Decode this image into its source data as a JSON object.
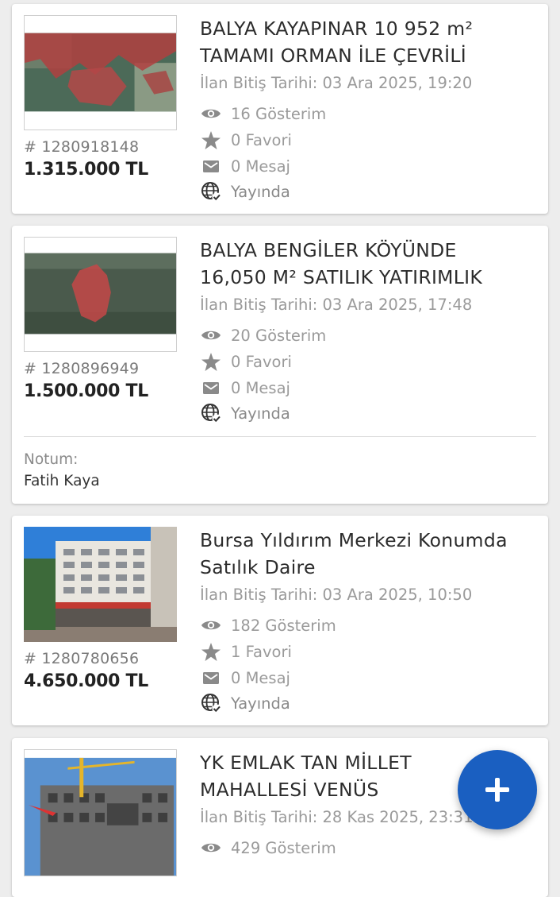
{
  "stat_icons": {
    "views": "eye-icon",
    "favorites": "star-icon",
    "messages": "envelope-icon",
    "status": "globe-check-icon"
  },
  "colors": {
    "fab": "#1a5fc1",
    "muted_text": "#9a9a9a",
    "price_text": "#222222"
  },
  "listings": [
    {
      "title": "BALYA KAYAPINAR 10 952 m²\nTAMAMI ORMAN İLE ÇEVRİLİ",
      "end_date": "İlan Bitiş Tarihi: 03 Ara 2025, 19:20",
      "views": "16 Gösterim",
      "favorites": "0 Favori",
      "messages": "0 Mesaj",
      "status": "Yayında",
      "listing_no": "# 1280918148",
      "price": "1.315.000 TL",
      "image": "aerial-map-red-parcels"
    },
    {
      "title": "BALYA BENGİLER KÖYÜNDE\n16,050 M² SATILIK YATIRIMLIK",
      "end_date": "İlan Bitiş Tarihi: 03 Ara 2025, 17:48",
      "views": "20 Gösterim",
      "favorites": "0 Favori",
      "messages": "0 Mesaj",
      "status": "Yayında",
      "listing_no": "# 1280896949",
      "price": "1.500.000 TL",
      "note_label": "Notum:",
      "note": "Fatih Kaya",
      "image": "aerial-map-red-parcel"
    },
    {
      "title": "Bursa Yıldırım Merkezi Konumda\nSatılık Daire",
      "end_date": "İlan Bitiş Tarihi: 03 Ara 2025, 10:50",
      "views": "182 Gösterim",
      "favorites": "1 Favori",
      "messages": "0 Mesaj",
      "status": "Yayında",
      "listing_no": "# 1280780656",
      "price": "4.650.000 TL",
      "image": "apartment-building-photo"
    },
    {
      "title": "YK EMLAK TAN MİLLET\nMAHALLESİ VENÜS",
      "end_date": "İlan Bitiş Tarihi: 28 Kas 2025, 23:31",
      "views": "429 Gösterim",
      "image": "construction-site-photo"
    }
  ],
  "fab": {
    "icon": "plus-icon"
  }
}
